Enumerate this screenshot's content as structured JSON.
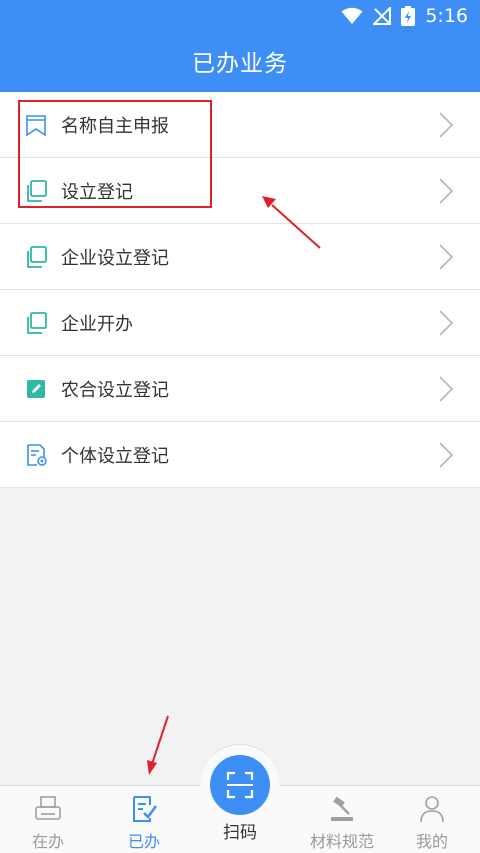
{
  "status_bar": {
    "time": "5:16"
  },
  "header": {
    "title": "已办业务"
  },
  "list": {
    "items": [
      {
        "label": "名称自主申报",
        "icon": "bookmark-icon"
      },
      {
        "label": "设立登记",
        "icon": "copy-icon"
      },
      {
        "label": "企业设立登记",
        "icon": "copy-icon"
      },
      {
        "label": "企业开办",
        "icon": "copy-icon"
      },
      {
        "label": "农合设立登记",
        "icon": "edit-icon"
      },
      {
        "label": "个体设立登记",
        "icon": "document-icon"
      }
    ]
  },
  "tabbar": {
    "tabs": [
      {
        "label": "在办",
        "icon": "printer-icon"
      },
      {
        "label": "已办",
        "icon": "checklist-icon",
        "active": true
      },
      {
        "label": "扫码",
        "icon": "scan-icon"
      },
      {
        "label": "材料规范",
        "icon": "gavel-icon"
      },
      {
        "label": "我的",
        "icon": "user-icon"
      }
    ]
  },
  "colors": {
    "primary": "#3d8ff5",
    "annotation": "#e0202a",
    "teal": "#2fb8a6"
  }
}
